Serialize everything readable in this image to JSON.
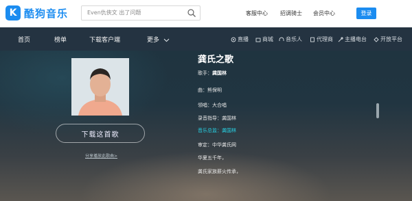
{
  "brand": {
    "badge": "K",
    "name": "酷狗音乐"
  },
  "search": {
    "text": "Even仇俠文 出了问题",
    "icon": "search-icon"
  },
  "top_links": [
    "客服中心",
    "招调骑士",
    "会员中心"
  ],
  "login_label": "登录",
  "nav": {
    "items": [
      "首页",
      "榜单",
      "下载客户端",
      "更多"
    ],
    "right": [
      {
        "icon": "live-icon",
        "label": "直播"
      },
      {
        "icon": "shop-icon",
        "label": "商城"
      },
      {
        "icon": "headphones-icon",
        "label": "音乐人"
      },
      {
        "icon": "agent-icon",
        "label": "代理商"
      },
      {
        "icon": "radio-icon",
        "label": "主播电台"
      },
      {
        "icon": "open-platform-icon",
        "label": "开放平台"
      }
    ]
  },
  "song": {
    "title": "龚氏之歌",
    "singer_label": "歌手：",
    "singer_name": "龚国林",
    "lyrics": [
      {
        "text": "曲：熊保明",
        "highlight": false
      },
      {
        "text": "领唱：大合唱",
        "highlight": false
      },
      {
        "text": "录音指导：龚国林",
        "highlight": false
      },
      {
        "text": "音乐总监：龚国林",
        "highlight": true
      },
      {
        "text": "审定：中华龚氏网",
        "highlight": false
      },
      {
        "text": "华夏五千年，",
        "highlight": false
      },
      {
        "text": "龚氏家族薪火传承，",
        "highlight": false
      }
    ]
  },
  "download_label": "下载这首歌",
  "share_label": "分享播放此歌曲>",
  "colors": {
    "accent": "#1b8cf0",
    "nav_bg": "#243341",
    "lyric_highlight": "#27d3e6"
  }
}
